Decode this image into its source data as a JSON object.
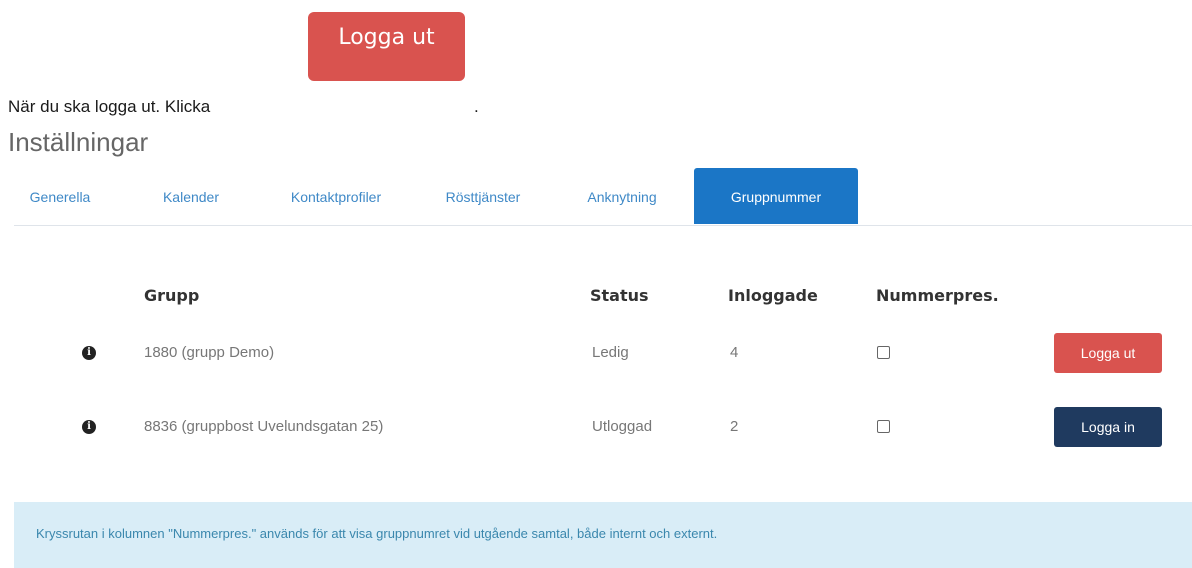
{
  "instruction": {
    "text": "När du ska logga ut. Klicka",
    "button_label": "Logga ut",
    "trailing": "."
  },
  "page": {
    "heading": "Inställningar"
  },
  "tabs": [
    {
      "label": "Generella"
    },
    {
      "label": "Kalender"
    },
    {
      "label": "Kontaktprofiler"
    },
    {
      "label": "Rösttjänster"
    },
    {
      "label": "Anknytning"
    },
    {
      "label": "Gruppnummer",
      "active": true
    }
  ],
  "table": {
    "headers": {
      "group": "Grupp",
      "status": "Status",
      "logged_in": "Inloggade",
      "number_pres": "Nummerpres."
    },
    "rows": [
      {
        "group": "1880 (grupp Demo)",
        "status": "Ledig",
        "logged_in": "4",
        "number_pres": false,
        "action": "Logga ut"
      },
      {
        "group": "8836 (gruppbost Uvelundsgatan 25)",
        "status": "Utloggad",
        "logged_in": "2",
        "number_pres": false,
        "action": "Logga in"
      }
    ]
  },
  "alert": {
    "text": "Kryssrutan i kolumnen \"Nummerpres.\" används för att visa gruppnumret vid utgående samtal, både internt och externt."
  },
  "colors": {
    "logout": "#d9534f",
    "login": "#1f3a5f",
    "tab_active": "#1b76c6",
    "tab_link": "#3f89c7",
    "alert_bg": "#d9edf7"
  }
}
